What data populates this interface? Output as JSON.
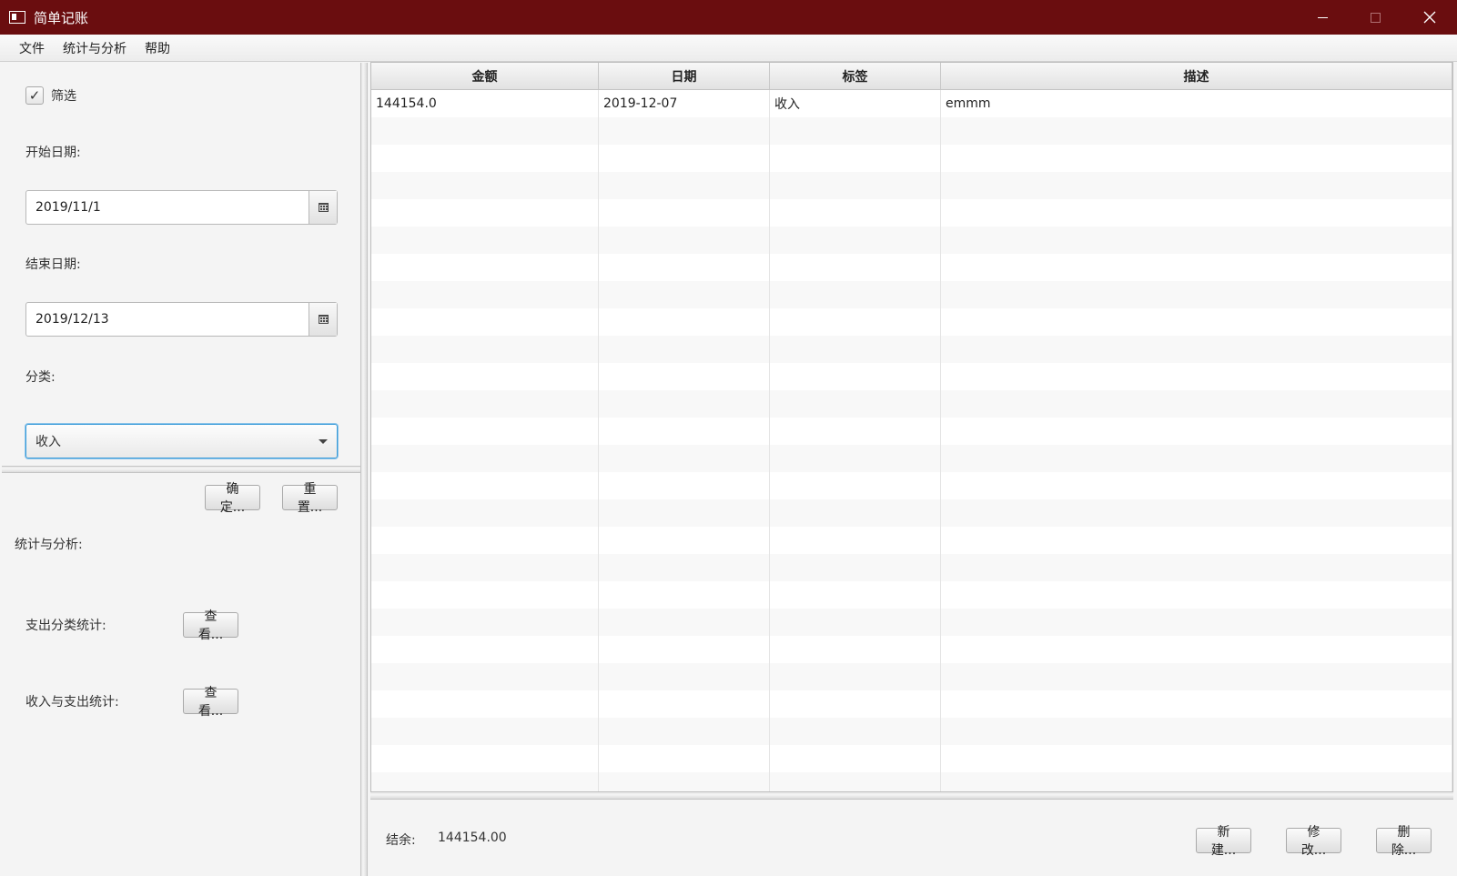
{
  "window": {
    "title": "简单记账"
  },
  "menu": {
    "items": [
      "文件",
      "统计与分析",
      "帮助"
    ]
  },
  "filter": {
    "checkbox_label": "筛选",
    "checkbox_mark": "✓",
    "start_label": "开始日期:",
    "start_value": "2019/11/1",
    "end_label": "结束日期:",
    "end_value": "2019/12/13",
    "category_label": "分类:",
    "category_value": "收入",
    "confirm_label": "确定...",
    "reset_label": "重置..."
  },
  "stats": {
    "section_label": "统计与分析:",
    "expense_label": "支出分类统计:",
    "expense_button": "查看...",
    "income_expense_label": "收入与支出统计:",
    "income_expense_button": "查看..."
  },
  "table": {
    "headers": [
      "金额",
      "日期",
      "标签",
      "描述"
    ],
    "rows": [
      [
        "144154.0",
        "2019-12-07",
        "收入",
        "emmm"
      ]
    ]
  },
  "footer": {
    "balance_label": "结余:",
    "balance_value": "144154.00",
    "new_label": "新建...",
    "edit_label": "修改...",
    "delete_label": "删除..."
  },
  "colors": {
    "titlebar": "#6a0d0f",
    "focus": "#3a9bd8"
  }
}
